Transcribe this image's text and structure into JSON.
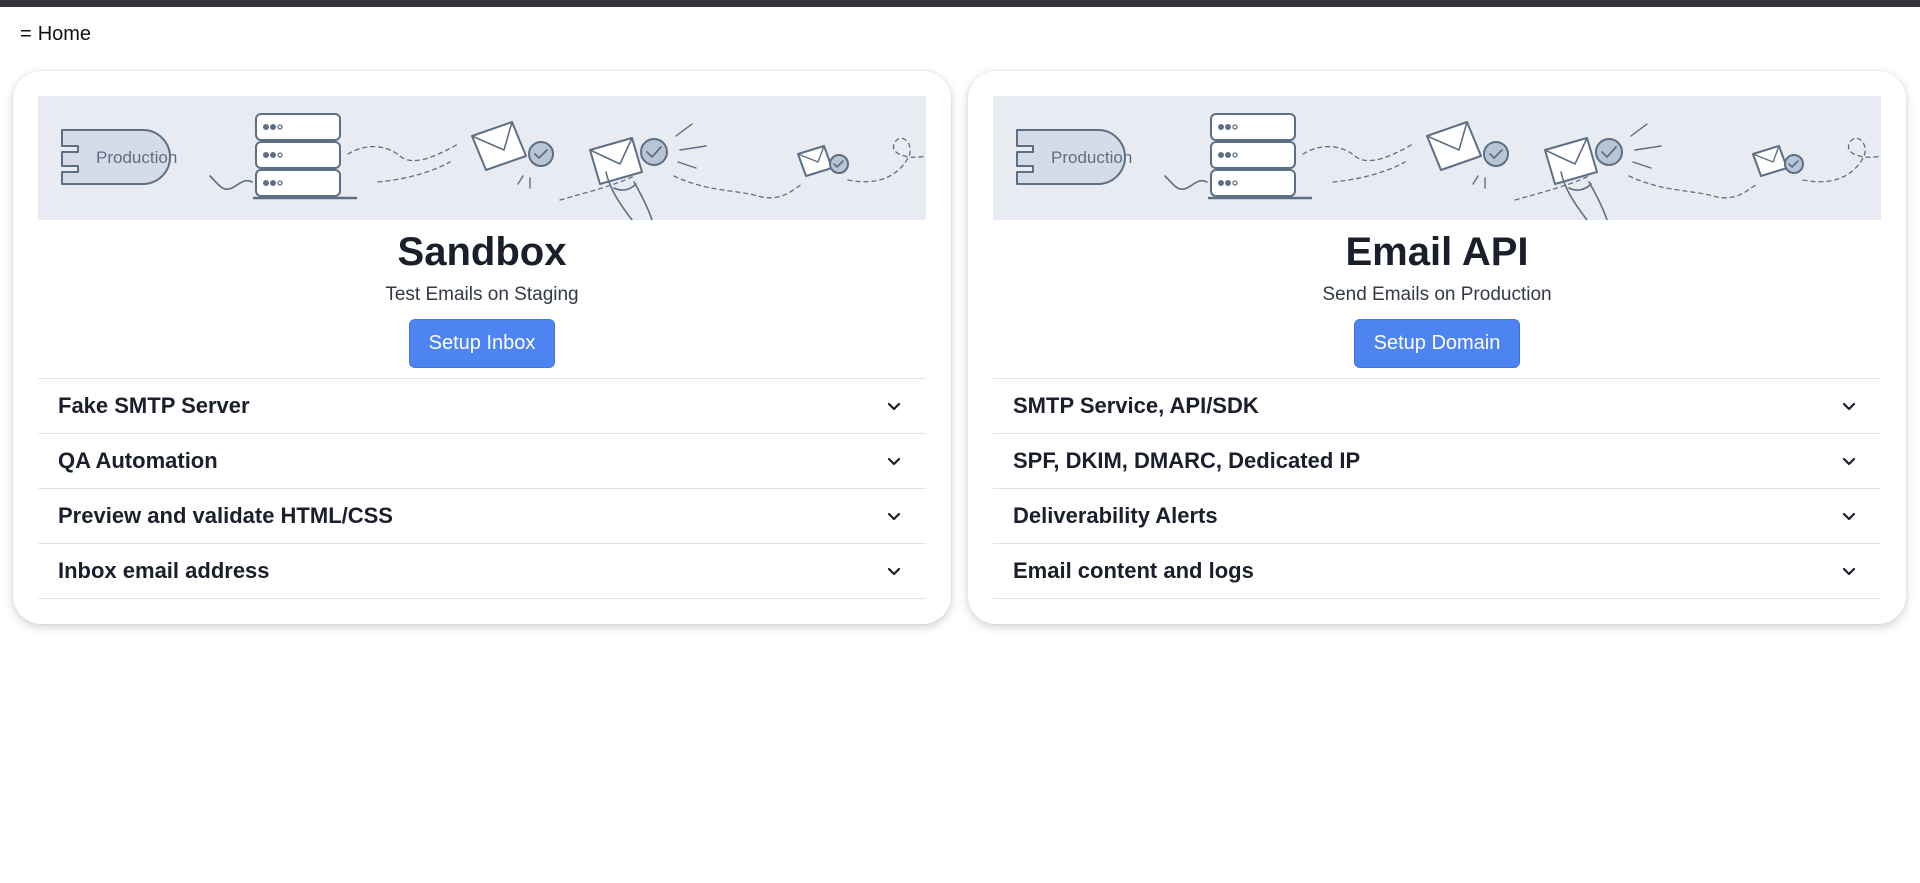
{
  "nav": {
    "menu_glyph": "=",
    "title": "Home"
  },
  "illustration": {
    "label": "Production",
    "icons": [
      "server-icon",
      "envelope-icon",
      "hand-icon",
      "checkmark-icon"
    ]
  },
  "cards": [
    {
      "title": "Sandbox",
      "subtitle": "Test Emails on Staging",
      "button": "Setup Inbox",
      "items": [
        {
          "label": "Fake SMTP Server"
        },
        {
          "label": "QA Automation"
        },
        {
          "label": "Preview and validate HTML/CSS"
        },
        {
          "label": "Inbox email address"
        }
      ]
    },
    {
      "title": "Email API",
      "subtitle": "Send Emails on Production",
      "button": "Setup Domain",
      "items": [
        {
          "label": "SMTP Service, API/SDK"
        },
        {
          "label": "SPF, DKIM, DMARC, Dedicated IP"
        },
        {
          "label": "Deliverability Alerts"
        },
        {
          "label": "Email content and logs"
        }
      ]
    }
  ],
  "colors": {
    "accent": "#4e84f2",
    "banner_bg": "#e8ebf1",
    "illustration_stroke": "#5d6f85",
    "top_strip": "#333338"
  }
}
